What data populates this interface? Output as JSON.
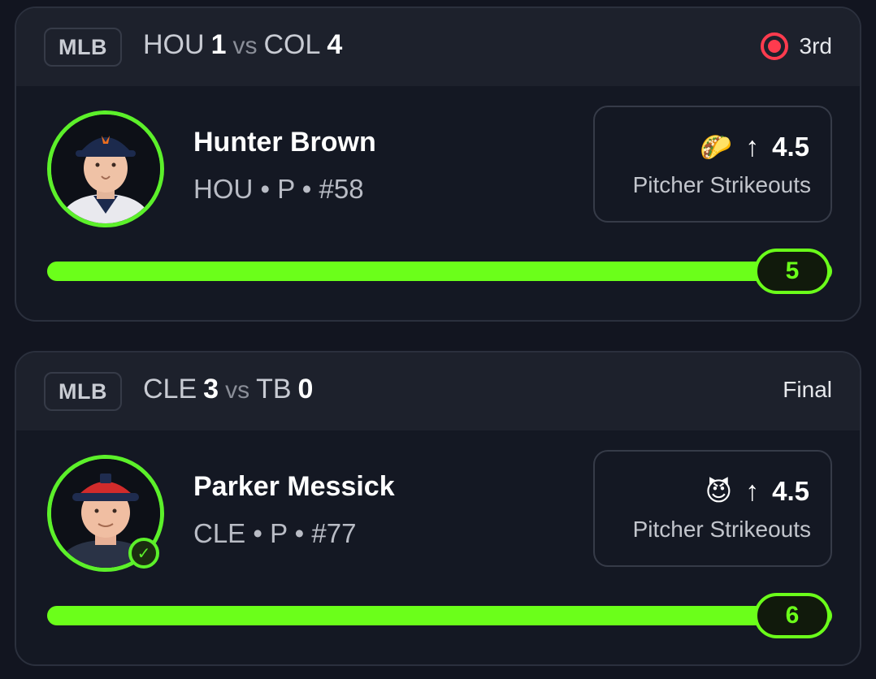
{
  "cards": [
    {
      "league": "MLB",
      "matchup": {
        "team_a": "HOU",
        "score_a": "1",
        "vs": "vs",
        "team_b": "COL",
        "score_b": "4"
      },
      "status": {
        "text": "3rd",
        "live": true,
        "live_color": "#ff3b4e"
      },
      "player": {
        "name": "Hunter Brown",
        "meta": "HOU • P • #58",
        "avatar_icon": "player-headshot",
        "verified": false
      },
      "prop": {
        "emoji": "🌮",
        "direction_icon": "arrow-up-icon",
        "direction": "↑",
        "line": "4.5",
        "stat": "Pitcher Strikeouts"
      },
      "progress": {
        "value": "5",
        "fraction": 1.0
      }
    },
    {
      "league": "MLB",
      "matchup": {
        "team_a": "CLE",
        "score_a": "3",
        "vs": "vs",
        "team_b": "TB",
        "score_b": "0"
      },
      "status": {
        "text": "Final",
        "live": false
      },
      "player": {
        "name": "Parker Messick",
        "meta": "CLE • P • #77",
        "avatar_icon": "player-headshot",
        "verified": true,
        "verified_mark": "✓"
      },
      "prop": {
        "emoji": "😈",
        "direction_icon": "arrow-up-icon",
        "direction": "↑",
        "line": "4.5",
        "stat": "Pitcher Strikeouts"
      },
      "progress": {
        "value": "6",
        "fraction": 1.0
      }
    }
  ],
  "colors": {
    "accent": "#6bff1a",
    "background": "#121520",
    "card": "#141823",
    "header": "#1d212c",
    "live": "#ff3b4e"
  }
}
